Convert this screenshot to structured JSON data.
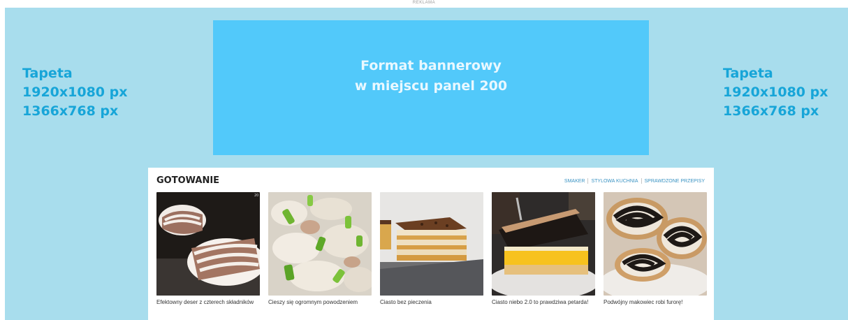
{
  "ad_label": "REKLAMA",
  "wallpaper": {
    "left": {
      "line1": "Tapeta",
      "line2": "1920x1080 px",
      "line3": "1366x768 px"
    },
    "right": {
      "line1": "Tapeta",
      "line2": "1920x1080 px",
      "line3": "1366x768 px"
    }
  },
  "banner": {
    "line1": "Format bannerowy",
    "line2": "w miejscu panel 200"
  },
  "panel": {
    "title": "GOTOWANIE",
    "links": [
      "SMAKER",
      "STYLOWA KUCHNIA",
      "SPRAWDZONE PRZEPISY"
    ],
    "cards": [
      {
        "title": "Efektowny deser z czterech składników",
        "image": "marble-dessert-image"
      },
      {
        "title": "Cieszy się ogromnym powodzeniem",
        "image": "salad-with-chives-image"
      },
      {
        "title": "Ciasto bez pieczenia",
        "image": "layered-cake-image"
      },
      {
        "title": "Ciasto niebo 2.0 to prawdziwa petarda!",
        "image": "orange-layer-cake-image"
      },
      {
        "title": "Podwójny makowiec robi furorę!",
        "image": "poppy-seed-roll-image"
      }
    ]
  },
  "colors": {
    "wallpaper": "#a8dded",
    "banner": "#52c9fa",
    "accent_text": "#17a5d8",
    "link": "#3a93c3"
  }
}
